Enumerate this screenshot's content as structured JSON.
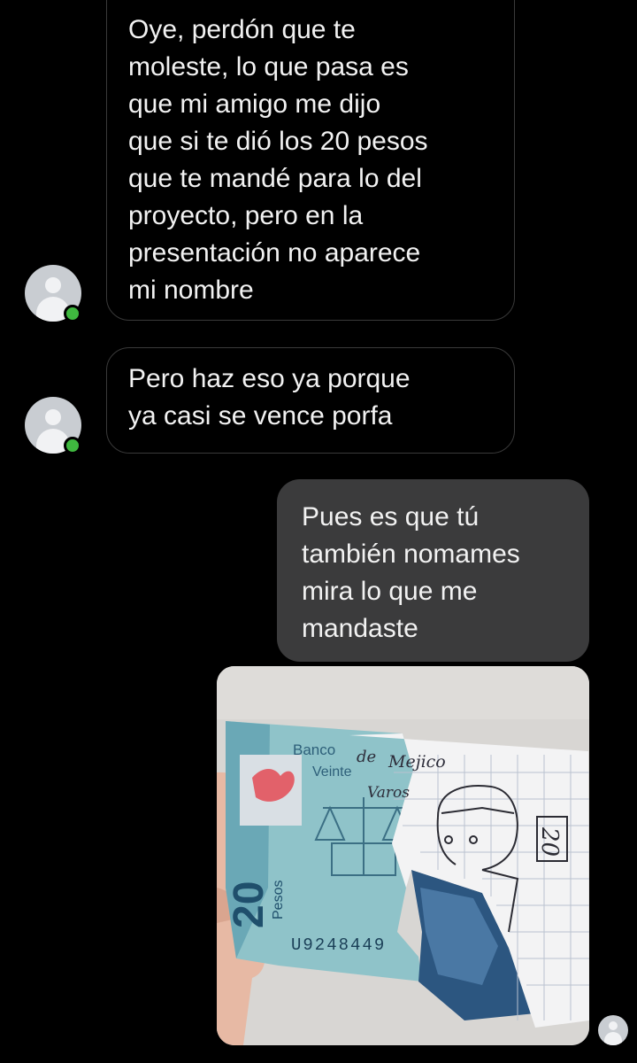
{
  "conversation": {
    "messages": [
      {
        "sender": "contact",
        "text": "Oye, perdón que te\nmoleste, lo que pasa es\nque mi amigo me dijo\nque si te dió los 20 pesos\nque te mandé para lo del\nproyecto, pero en la\npresentación no aparece\nmi nombre"
      },
      {
        "sender": "contact",
        "text": "Pero haz eso ya porque\nya casi se vence porfa"
      },
      {
        "sender": "me",
        "text": "Pues es que tú\ntambién nomames\nmira lo que me\nmandaste"
      }
    ],
    "photo": {
      "bank_name": "Banco de México",
      "denomination_label": "Veinte Pesos",
      "value_number": "20",
      "currency_word": "Pesos",
      "serial": "U9248449",
      "handwritten_bank": "Mejico",
      "handwritten_word": "Varos",
      "handwritten_value": "20",
      "drawn_bank_prefix": "de"
    }
  },
  "presence": {
    "status": "online",
    "status_color": "#3fb93f"
  },
  "theme": {
    "background": "#000000",
    "incoming_border": "#3a3a3a",
    "outgoing_bubble": "#3b3b3c",
    "text": "#f2f2f2"
  },
  "icons": {
    "avatar": "default-avatar-icon",
    "presence": "online-dot-icon"
  }
}
